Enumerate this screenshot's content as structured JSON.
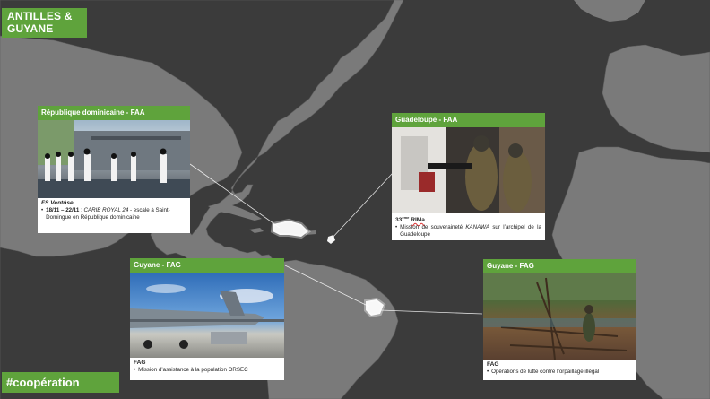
{
  "header": {
    "title_line1": "ANTILLES &",
    "title_line2": "GUYANE"
  },
  "footer": {
    "hashtag": "#coopération"
  },
  "cards": {
    "dominicaine": {
      "title": "République dominicaine - FAA",
      "unit": "FS Ventôse",
      "date": "18/11 – 22/11",
      "event": "CARIB ROYAL 24",
      "text": " - escale à Saint-Domingue en République dominicaine"
    },
    "guadeloupe": {
      "title": "Guadeloupe - FAA",
      "unit_num": "33",
      "unit_sup": "ème",
      "unit_name": "RIMa",
      "text_pre": "Mission de souveraineté ",
      "text_em": "KANAWA",
      "text_post": " sur l’archipel de la Guadeloupe"
    },
    "guyane1": {
      "title": "Guyane - FAG",
      "unit": "FAG",
      "text": "Mission d’assistance à la population ORSEC"
    },
    "guyane2": {
      "title": "Guyane - FAG",
      "unit": "FAG",
      "text": "Opérations de lutte contre l’orpaillage illégal"
    }
  },
  "colors": {
    "accent": "#5fa33c",
    "ocean": "#3b3b3b",
    "land": "#7a7a7a",
    "highlight": "#ffffff"
  }
}
